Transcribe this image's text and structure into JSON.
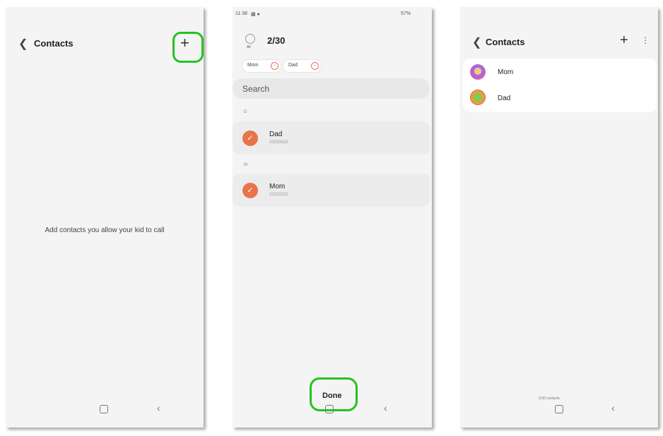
{
  "screen1": {
    "title": "Contacts",
    "empty_text": "Add contacts you allow your kid to call"
  },
  "screen2": {
    "status": {
      "time": "11:38",
      "right": "57%"
    },
    "select_all_label": "All",
    "count": "2/30",
    "chips": [
      "Mom",
      "Dad"
    ],
    "search_placeholder": "Search",
    "sections": [
      {
        "letter": "D",
        "name": "Dad",
        "number": "33333333"
      },
      {
        "letter": "M",
        "name": "Mom",
        "number": "22222222"
      }
    ],
    "done_label": "Done"
  },
  "screen3": {
    "title": "Contacts",
    "contacts": [
      "Mom",
      "Dad"
    ],
    "footer": "2/30 contacts"
  },
  "colors": {
    "accent": "#e8744a",
    "highlight": "#22c41d"
  }
}
